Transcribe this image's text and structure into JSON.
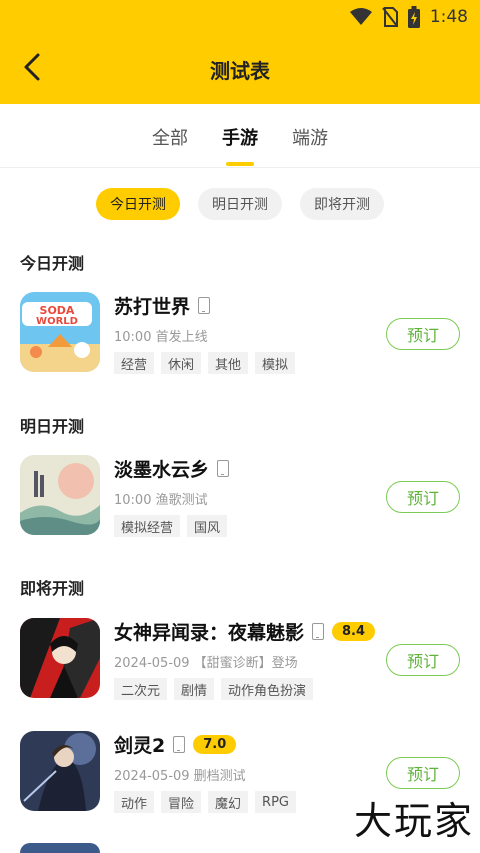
{
  "status_bar": {
    "time": "1:48",
    "icons": [
      "wifi-icon",
      "no-sim-icon",
      "battery-charging-icon"
    ]
  },
  "header": {
    "title": "测试表",
    "back_icon": "chevron-left-icon"
  },
  "tabs": [
    {
      "label": "全部"
    },
    {
      "label": "手游"
    },
    {
      "label": "端游"
    }
  ],
  "filters": [
    {
      "label": "今日开测"
    },
    {
      "label": "明日开测"
    },
    {
      "label": "即将开测"
    }
  ],
  "sections": {
    "today": {
      "title": "今日开测"
    },
    "tomorrow": {
      "title": "明日开测"
    },
    "upcoming": {
      "title": "即将开测"
    }
  },
  "games": [
    {
      "name": "苏打世界",
      "info": "10:00 首发上线",
      "tags": [
        "经营",
        "休闲",
        "其他",
        "模拟"
      ],
      "score": "",
      "button": "预订"
    },
    {
      "name": "淡墨水云乡",
      "info": "10:00 渔歌测试",
      "tags": [
        "模拟经营",
        "国风"
      ],
      "score": "",
      "button": "预订"
    },
    {
      "name": "女神异闻录：夜幕魅影",
      "info": "2024-05-09 【甜蜜诊断】登场",
      "tags": [
        "二次元",
        "剧情",
        "动作角色扮演"
      ],
      "score": "8.4",
      "button": "预订"
    },
    {
      "name": "剑灵2",
      "info": "2024-05-09 删档测试",
      "tags": [
        "动作",
        "冒险",
        "魔幻",
        "RPG"
      ],
      "score": "7.0",
      "button": "预订"
    }
  ],
  "watermark": "大玩家",
  "colors": {
    "accent": "#FFCC00",
    "reserve_green": "#5FB33A"
  }
}
